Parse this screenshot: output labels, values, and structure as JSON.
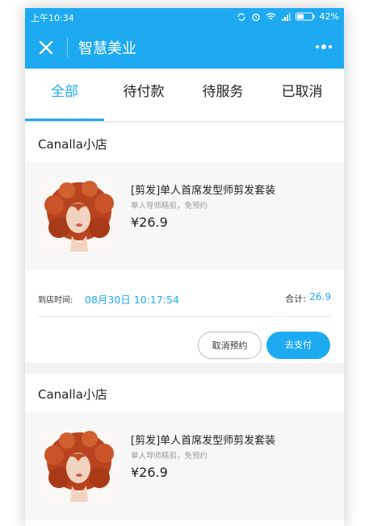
{
  "status_bar": {
    "time": "上午10:34",
    "battery": "42%"
  },
  "header": {
    "title": "智慧美业"
  },
  "tabs": [
    {
      "label": "全部",
      "active": true
    },
    {
      "label": "待付款",
      "active": false
    },
    {
      "label": "待服务",
      "active": false
    },
    {
      "label": "已取消",
      "active": false
    }
  ],
  "orders": [
    {
      "shop": "Canalla小店",
      "item_title": "[剪发]单人首席发型师剪发套装",
      "item_subtitle": "单人导师精剪，免预约",
      "price": "¥26.9",
      "arrive_label": "到店时间:",
      "arrive_time": "08月30日 10:17:54",
      "total_label": "合计:",
      "total_value": "26.9",
      "cancel_label": "取消预约",
      "pay_label": "去支付"
    },
    {
      "shop": "Canalla小店",
      "item_title": "[剪发]单人首席发型师剪发套装",
      "item_subtitle": "单人导师精剪，免预约",
      "price": "¥26.9"
    }
  ],
  "colors": {
    "accent": "#1eaaf1"
  }
}
